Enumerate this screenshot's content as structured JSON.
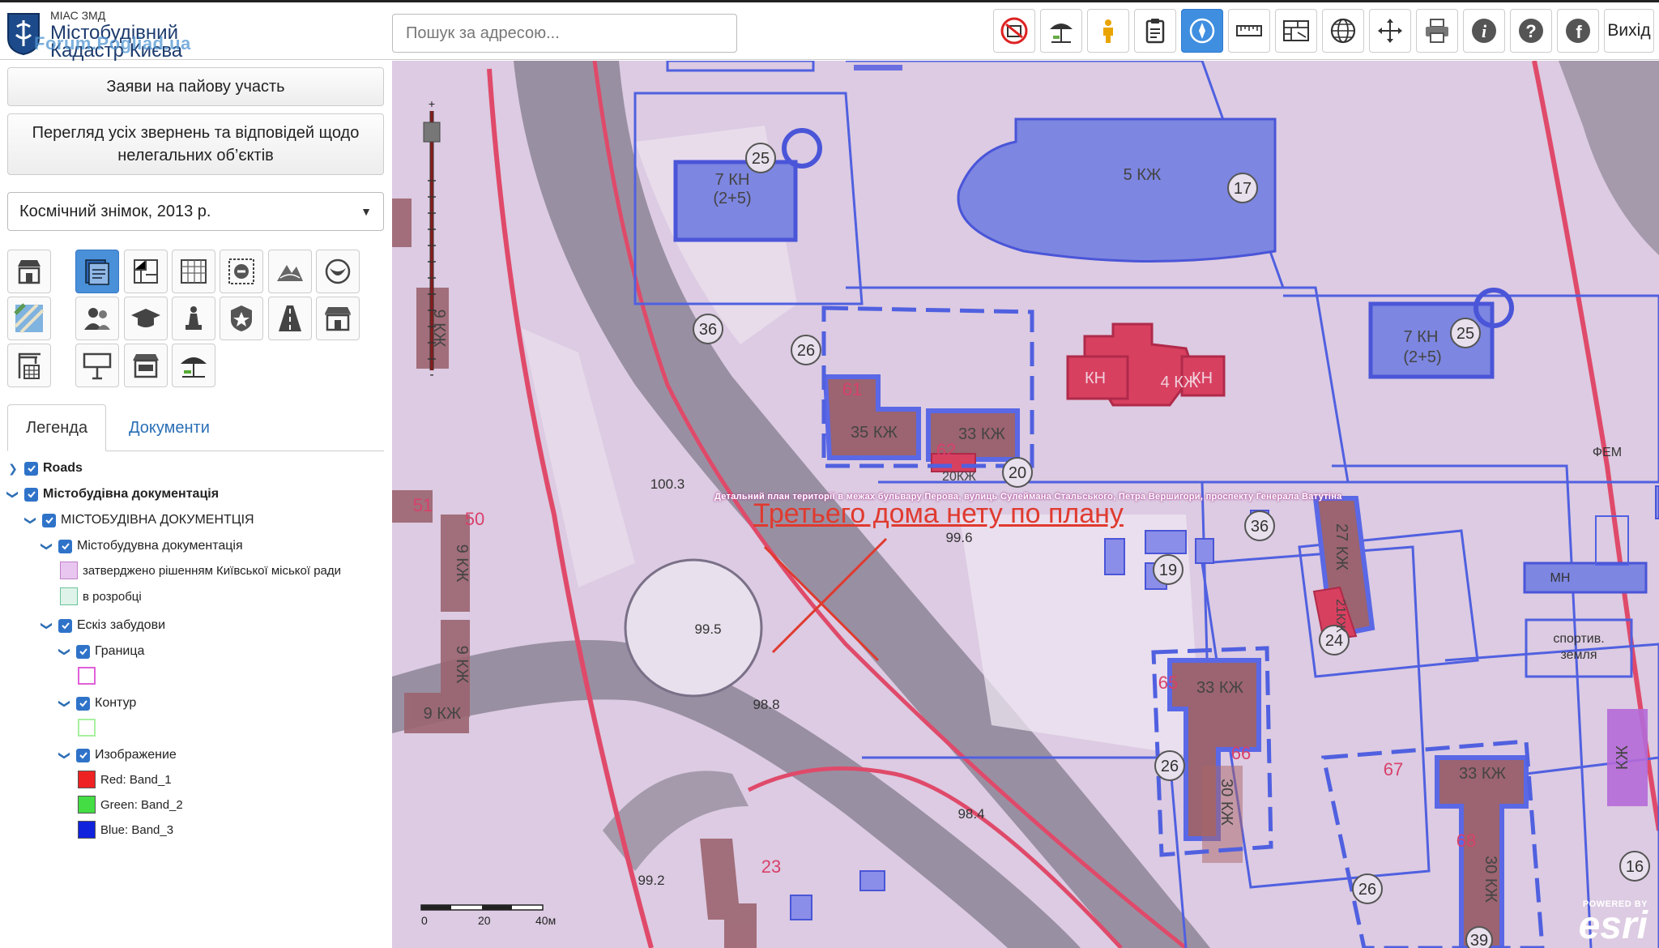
{
  "header": {
    "logo_line1": "МІАС ЗМД",
    "logo_line2": "Містобудівний",
    "logo_line3": "Кадастр Києва",
    "logo_watermark": "Forum.Pogliad.ua",
    "search_placeholder": "Пошук за адресою...",
    "exit_label": "Вихід",
    "toolbar_icons": [
      "no-construction-icon",
      "beach-umbrella-icon",
      "street-view-person-icon",
      "clipboard-icon",
      "compass-icon",
      "ruler-icon",
      "layers-map-icon",
      "globe-icon",
      "pan-arrows-icon",
      "printer-icon",
      "info-icon",
      "help-icon",
      "facebook-icon"
    ]
  },
  "sidebar": {
    "btn_shared_participation": "Заяви на пайову участь",
    "btn_illegal_objects": "Перегляд усіх звернень та відповідей щодо нелегальних об’єктів",
    "basemap_selected": "Космічний знімок, 2013 р.",
    "tabs": {
      "legend": "Легенда",
      "documents": "Документи"
    },
    "tree": {
      "roads": "Roads",
      "urban_docs": "Містобудівна документація",
      "urban_docs_upper": "МІСТОБУДІВНА ДОКУМЕНТЦІЯ",
      "urban_docs_sub": "Містобудувна документація",
      "approved": "затверджено рішенням Київської міської ради",
      "in_progress": "в розробці",
      "sketch": "Ескіз забудови",
      "border": "Граница",
      "contour": "Контур",
      "image": "Изображение",
      "red": "Red: Band_1",
      "green": "Green: Band_2",
      "blue": "Blue: Band_3"
    },
    "colors": {
      "approved": "#e9c6f0",
      "in_progress": "#dff3ea",
      "border": "#e060d8",
      "contour": "#a8f0a0",
      "red": "#ee2222",
      "green": "#44dd44",
      "blue": "#1122dd"
    }
  },
  "map": {
    "plan_caption": "Детальний план території в межах бульвару Перова, вулиць Сулеймана Стальського, Петра Вершигори, проспекту Генерала Ватутіна",
    "annotation": "Третьего дома нету по плану",
    "scale_labels": [
      "0",
      "20",
      "40м"
    ],
    "esri_powered": "POWERED BY",
    "esri_name": "esri",
    "labels": {
      "b1": "5 КЖ",
      "b2": "7 КН",
      "b2s": "(2+5)",
      "b3": "7 КН",
      "b3s": "(2+5)",
      "b4": "4 КЖ",
      "kn": "КН",
      "b5": "35 КЖ",
      "b6": "33 КЖ",
      "b7": "20КЖ",
      "b8": "33 КЖ",
      "b9": "30 КЖ",
      "b10": "33 КЖ",
      "b11": "30 КЖ",
      "b12": "27 КЖ",
      "b13": "21КЖ",
      "b14": "9 КЖ",
      "b15": "9 КЖ",
      "b16": "9 КЖ",
      "b17": "9 КЖ",
      "b18": "КЖ",
      "c25a": "25",
      "c17": "17",
      "c36a": "36",
      "c26a": "26",
      "c25b": "25",
      "c20": "20",
      "c36b": "36",
      "c19": "19",
      "c24": "24",
      "c26b": "26",
      "c26c": "26",
      "c39": "39",
      "c16": "16",
      "n61": "61",
      "n62": "62",
      "n65": "65",
      "n66": "66",
      "n67": "67",
      "n68": "68",
      "n51": "51",
      "n50": "50",
      "n23": "23",
      "e1003": "100.3",
      "e995": "99.5",
      "e988": "98.8",
      "e996": "99.6",
      "e984": "98.4",
      "e992": "99.2",
      "mn": "МН",
      "sport": "спортив.",
      "zemlya": "земля",
      "fem": "ФЕМ"
    }
  }
}
